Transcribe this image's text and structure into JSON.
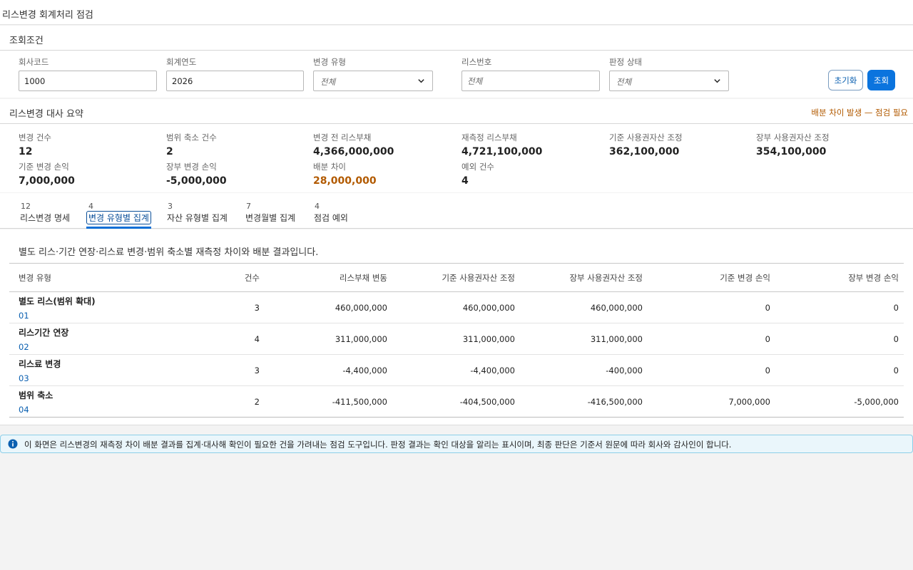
{
  "app": {
    "title": "리스변경 회계처리 점검"
  },
  "search": {
    "header": "조회조건",
    "company_code": {
      "label": "회사코드",
      "value": "1000"
    },
    "fiscal_year": {
      "label": "회계연도",
      "value": "2026"
    },
    "change_type": {
      "label": "변경 유형",
      "value": "전체"
    },
    "lease_no": {
      "label": "리스번호",
      "placeholder": "전체"
    },
    "judgement": {
      "label": "판정 상태",
      "value": "전체"
    },
    "reset_label": "초기화",
    "search_label": "조회"
  },
  "summary": {
    "header": "리스변경 대사 요약",
    "warning": "배분 차이 발생 — 점검 필요",
    "kpis": [
      {
        "label": "변경 건수",
        "value": "12"
      },
      {
        "label": "범위 축소 건수",
        "value": "2"
      },
      {
        "label": "변경 전 리스부채",
        "value": "4,366,000,000"
      },
      {
        "label": "재측정 리스부채",
        "value": "4,721,100,000"
      },
      {
        "label": "기준 사용권자산 조정",
        "value": "362,100,000"
      },
      {
        "label": "장부 사용권자산 조정",
        "value": "354,100,000"
      },
      {
        "label": "기준 변경 손익",
        "value": "7,000,000"
      },
      {
        "label": "장부 변경 손익",
        "value": "-5,000,000"
      },
      {
        "label": "배분 차이",
        "value": "28,000,000"
      },
      {
        "label": "예외 건수",
        "value": "4"
      }
    ]
  },
  "tabs": [
    {
      "count": "12",
      "label": "리스변경 명세"
    },
    {
      "count": "4",
      "label": "변경 유형별 집계"
    },
    {
      "count": "3",
      "label": "자산 유형별 집계"
    },
    {
      "count": "7",
      "label": "변경월별 집계"
    },
    {
      "count": "4",
      "label": "점검 예외"
    }
  ],
  "main": {
    "description": "별도 리스·기간 연장·리스료 변경·범위 축소별 재측정 차이와 배분 결과입니다.",
    "columns": [
      "변경 유형",
      "건수",
      "리스부채 변동",
      "기준 사용권자산 조정",
      "장부 사용권자산 조정",
      "기준 변경 손익",
      "장부 변경 손익"
    ],
    "rows": [
      {
        "name": "별도 리스(범위 확대)",
        "code": "01",
        "count": "3",
        "liability": "460,000,000",
        "std_rou": "460,000,000",
        "book_rou": "460,000,000",
        "std_pl": "0",
        "book_pl": "0"
      },
      {
        "name": "리스기간 연장",
        "code": "02",
        "count": "4",
        "liability": "311,000,000",
        "std_rou": "311,000,000",
        "book_rou": "311,000,000",
        "std_pl": "0",
        "book_pl": "0"
      },
      {
        "name": "리스료 변경",
        "code": "03",
        "count": "3",
        "liability": "-4,400,000",
        "std_rou": "-4,400,000",
        "book_rou": "-400,000",
        "std_pl": "0",
        "book_pl": "0"
      },
      {
        "name": "범위 축소",
        "code": "04",
        "count": "2",
        "liability": "-411,500,000",
        "std_rou": "-404,500,000",
        "book_rou": "-416,500,000",
        "std_pl": "7,000,000",
        "book_pl": "-5,000,000"
      }
    ]
  },
  "info": {
    "text": "이 화면은 리스변경의 재측정 차이 배분 결과를 집계·대사해 확인이 필요한 건을 가려내는 점검 도구입니다. 판정 결과는 확인 대상을 알리는 표시이며, 최종 판단은 기준서 원문에 따라 회사와 감사인이 합니다."
  },
  "colors": {
    "accent": "#0b74de",
    "warning": "#b25a00",
    "info_bg": "#eaf6fb"
  },
  "icons": {
    "info": "info-icon",
    "select": "chevron-down-icon"
  }
}
